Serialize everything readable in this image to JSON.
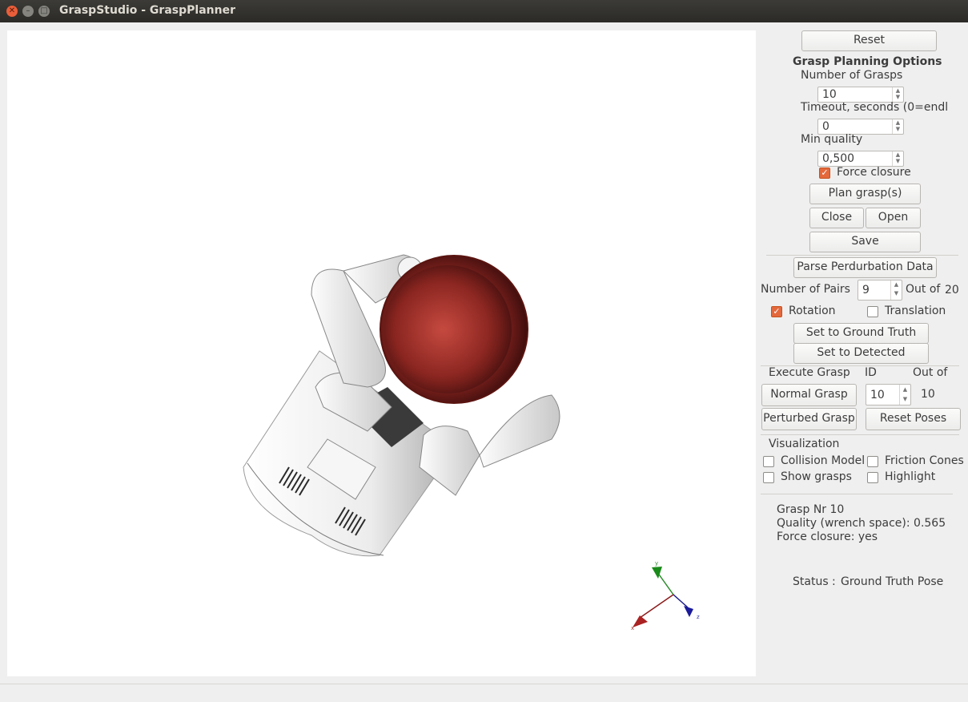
{
  "window": {
    "title": "GraspStudio - GraspPlanner"
  },
  "panel": {
    "reset_label": "Reset",
    "options_heading": "Grasp Planning Options",
    "num_grasps_label": "Number of Grasps",
    "num_grasps_value": "10",
    "timeout_label": "Timeout, seconds (0=endl",
    "timeout_value": "0",
    "min_quality_label": "Min quality",
    "min_quality_value": "0,500",
    "force_closure_label": "Force closure",
    "force_closure_checked": true,
    "plan_label": "Plan grasp(s)",
    "close_label": "Close",
    "open_label": "Open",
    "save_label": "Save",
    "parse_label": "Parse Perdurbation Data",
    "pairs_label": "Number of Pairs",
    "pairs_value": "9",
    "pairs_outof_label": "Out of",
    "pairs_outof_value": "20",
    "rotation_label": "Rotation",
    "rotation_checked": true,
    "translation_label": "Translation",
    "translation_checked": false,
    "ground_truth_label": "Set to Ground Truth",
    "detected_label": "Set to Detected",
    "execute_label": "Execute Grasp",
    "id_label": "ID",
    "exec_outof_label": "Out of",
    "normal_label": "Normal Grasp",
    "id_value": "10",
    "exec_outof_value": "10",
    "perturbed_label": "Perturbed Grasp",
    "reset_poses_label": "Reset Poses",
    "vis_heading": "Visualization",
    "collision_label": "Collision Model",
    "friction_label": "Friction Cones",
    "show_grasps_label": "Show grasps",
    "highlight_label": "Highlight",
    "grasp_nr_text": "Grasp Nr 10",
    "quality_text": "Quality (wrench space): 0.565",
    "fc_text": "Force closure: yes",
    "status_label": "Status :",
    "status_value": "Ground Truth Pose"
  },
  "axes_labels": {
    "x": "x",
    "y": "y",
    "z": "z"
  },
  "colors": {
    "accent": "#e4683c",
    "object": "#a8302a",
    "hand": "#f2f2f2"
  }
}
